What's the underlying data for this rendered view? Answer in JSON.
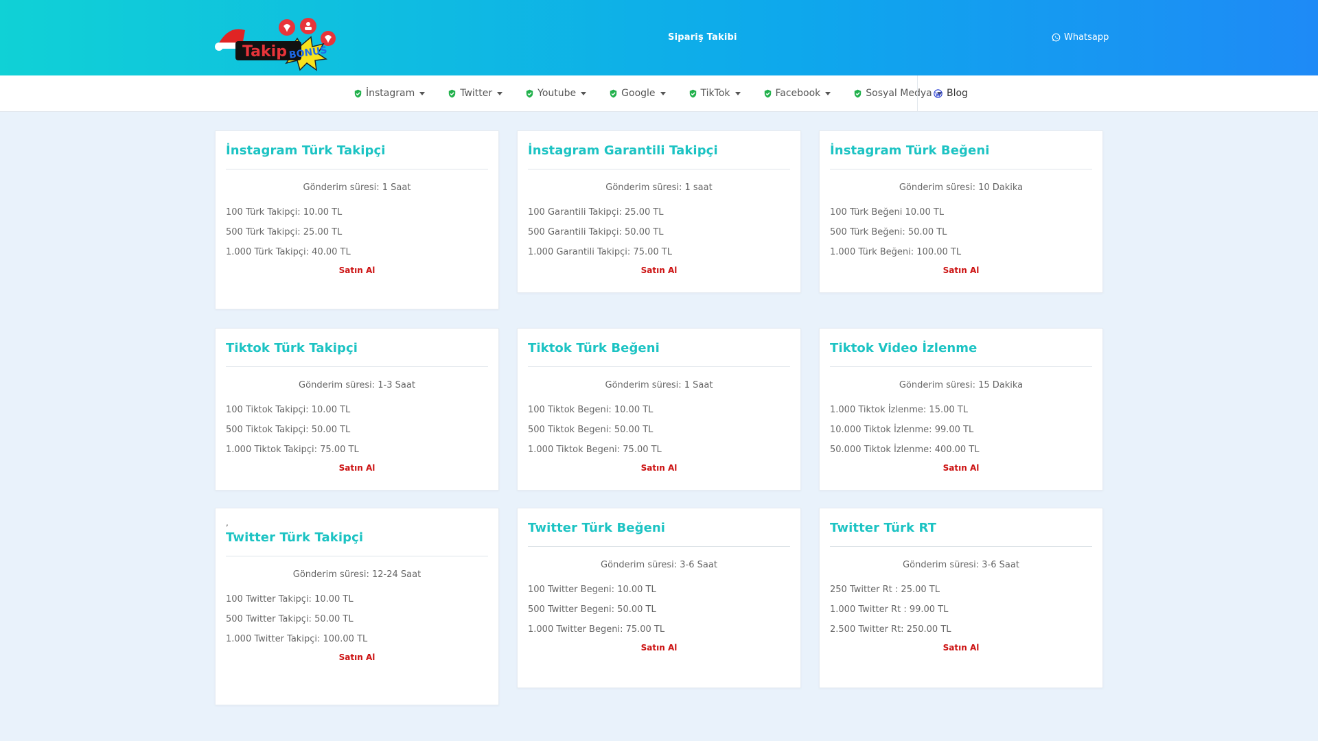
{
  "header": {
    "logo_text": "Takip BONUS",
    "order_tracking": "Sipariş Takibi",
    "whatsapp": "Whatsapp"
  },
  "nav": {
    "items": [
      {
        "label": "İnstagram"
      },
      {
        "label": "Twitter"
      },
      {
        "label": "Youtube"
      },
      {
        "label": "Google"
      },
      {
        "label": "TikTok"
      },
      {
        "label": "Facebook"
      },
      {
        "label": "Sosyal Medya"
      }
    ],
    "blog": "Blog"
  },
  "colors": {
    "accent": "#1cc3c3",
    "buy": "#cc1111",
    "header_start": "#10d1d6",
    "header_end": "#1e8af6"
  },
  "cards": [
    {
      "title": "İnstagram Türk Takipçi",
      "time": "Gönderim süresi: 1 Saat",
      "rows": [
        "100 Türk Takipçi: 10.00 TL",
        "500 Türk Takipçi: 25.00 TL",
        "1.000 Türk Takipçi: 40.00 TL"
      ],
      "buy": "Satın Al"
    },
    {
      "title": "İnstagram Garantili Takipçi",
      "time": "Gönderim süresi: 1 saat",
      "rows": [
        "100 Garantili Takipçi: 25.00 TL",
        "500 Garantili Takipçi: 50.00 TL",
        "1.000 Garantili Takipçi: 75.00 TL"
      ],
      "buy": "Satın Al"
    },
    {
      "title": "İnstagram Türk Beğeni",
      "time": "Gönderim süresi: 10 Dakika",
      "rows": [
        "100 Türk Beğeni 10.00 TL",
        "500 Türk Beğeni: 50.00 TL",
        "1.000 Türk Beğeni: 100.00 TL"
      ],
      "buy": "Satın Al"
    },
    {
      "title": "Tiktok Türk Takipçi",
      "time": "Gönderim süresi: 1-3 Saat",
      "rows": [
        "100 Tiktok Takipçi: 10.00 TL",
        "500 Tiktok Takipçi: 50.00 TL",
        "1.000 Tiktok Takipçi: 75.00 TL"
      ],
      "buy": "Satın Al"
    },
    {
      "title": "Tiktok Türk Beğeni",
      "time": "Gönderim süresi: 1 Saat",
      "rows": [
        "100 Tiktok Begeni: 10.00 TL",
        "500 Tiktok Begeni: 50.00 TL",
        "1.000 Tiktok Begeni: 75.00 TL"
      ],
      "buy": "Satın Al"
    },
    {
      "title": "Tiktok Video İzlenme",
      "time": "Gönderim süresi: 15 Dakika",
      "rows": [
        "1.000 Tiktok İzlenme: 15.00 TL",
        "10.000 Tiktok İzlenme: 99.00 TL",
        "50.000 Tiktok İzlenme: 400.00 TL"
      ],
      "buy": "Satın Al"
    },
    {
      "prefix": ",",
      "title": "Twitter Türk Takipçi",
      "time": "Gönderim süresi: 12-24 Saat",
      "rows": [
        "100 Twitter Takipçi: 10.00 TL",
        "500 Twitter Takipçi: 50.00 TL",
        "1.000 Twitter Takipçi: 100.00 TL"
      ],
      "buy": "Satın Al"
    },
    {
      "title": "Twitter Türk Beğeni",
      "time": "Gönderim süresi: 3-6 Saat",
      "rows": [
        "100 Twitter Begeni: 10.00 TL",
        "500 Twitter Begeni: 50.00 TL",
        "1.000 Twitter Begeni: 75.00 TL"
      ],
      "buy": "Satın Al"
    },
    {
      "title": "Twitter Türk RT",
      "time": "Gönderim süresi: 3-6 Saat",
      "rows": [
        "250 Twitter Rt : 25.00 TL",
        "1.000 Twitter Rt : 99.00 TL",
        "2.500 Twitter Rt: 250.00 TL"
      ],
      "buy": "Satın Al"
    }
  ]
}
